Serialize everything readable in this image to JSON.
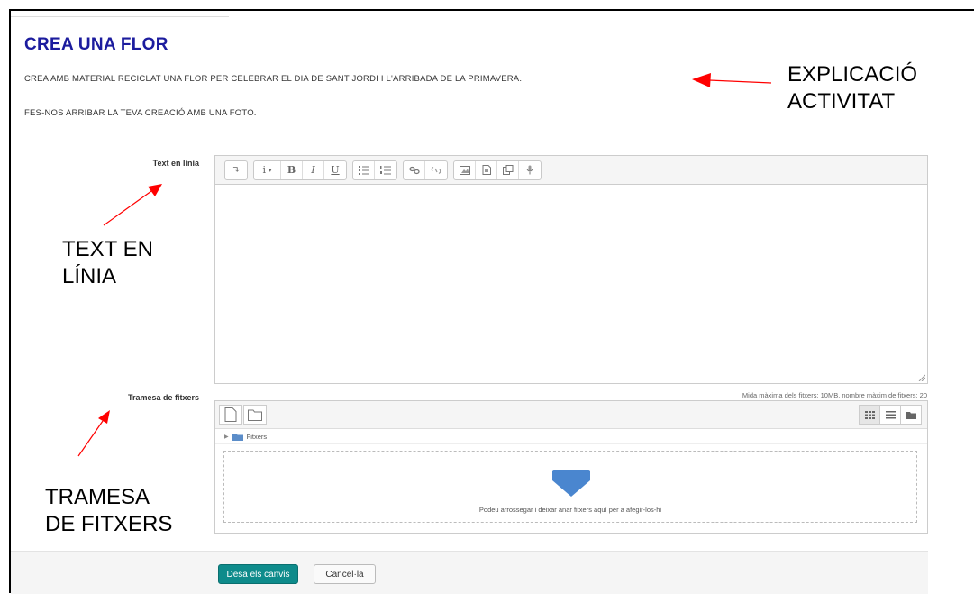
{
  "activity": {
    "title": "CREA UNA FLOR",
    "description_1": "CREA AMB MATERIAL RECICLAT UNA FLOR PER CELEBRAR EL DIA DE SANT JORDI I L'ARRIBADA DE LA PRIMAVERA.",
    "description_2": "FES-NOS ARRIBAR LA TEVA CREACIÓ AMB UNA FOTO."
  },
  "annotations": {
    "explanation_line1": "EXPLICACIÓ",
    "explanation_line2": "ACTIVITAT",
    "online_text_line1": "TEXT EN",
    "online_text_line2": "LÍNIA",
    "file_submission_line1": "TRAMESA",
    "file_submission_line2": "DE FITXERS"
  },
  "form": {
    "online_text_label": "Text en línia",
    "file_submission_label": "Tramesa de fitxers",
    "file_limits": "Mida màxima dels fitxers: 10MB, nombre màxim de fitxers: 20",
    "folder_name": "Fitxers",
    "drop_hint": "Podeu arrossegar i deixar anar fitxers aquí per a afegir-los-hi"
  },
  "toolbar": {
    "italic": "I",
    "bold": "B",
    "underline": "U",
    "info": "i",
    "collapse": "↴"
  },
  "footer": {
    "save_label": "Desa els canvis",
    "cancel_label": "Cancel·la"
  },
  "colors": {
    "title": "#1c1c9e",
    "annotation_arrow": "#ff0000",
    "save_button": "#0e8b8b"
  }
}
